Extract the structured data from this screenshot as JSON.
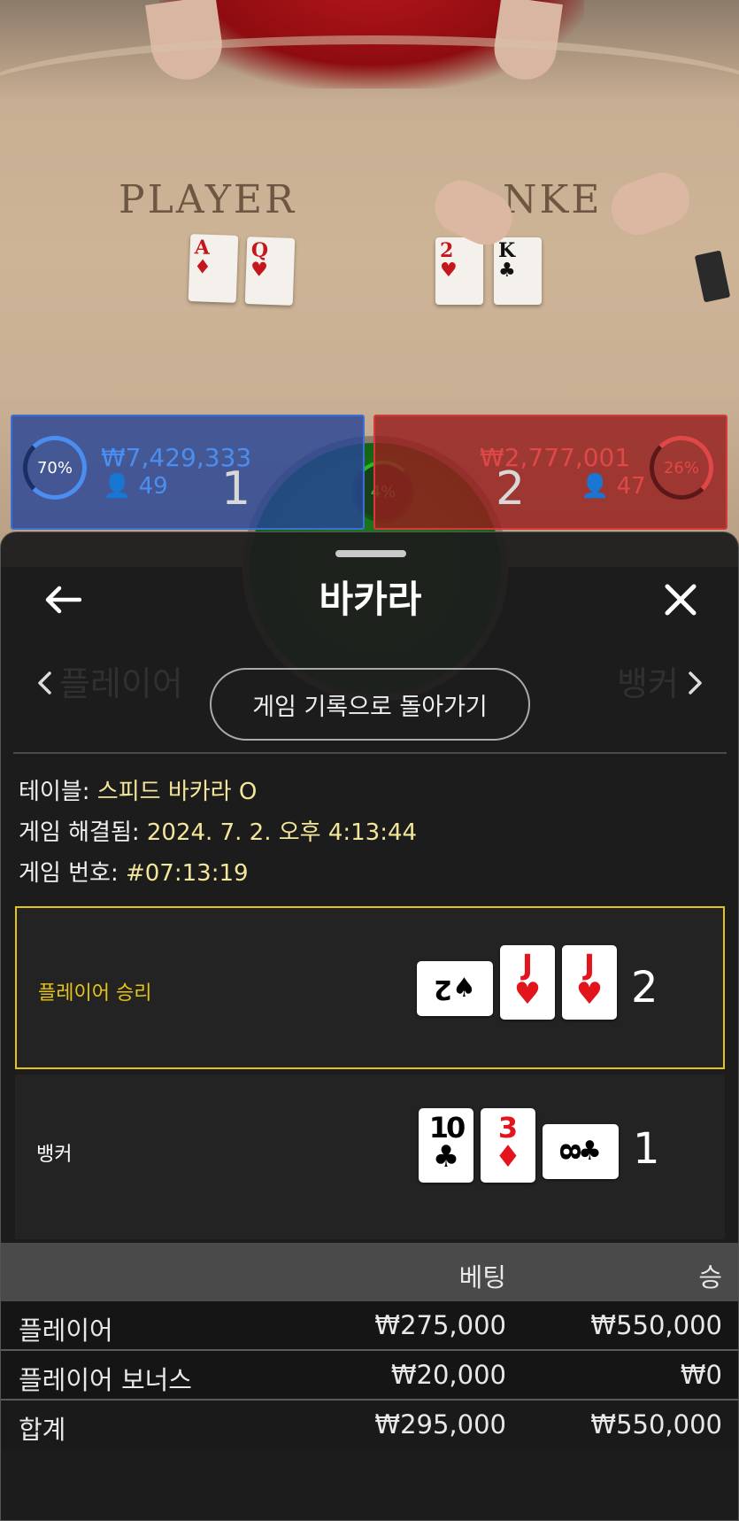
{
  "video": {
    "player_label": "PLAYER",
    "banker_label": "NKE",
    "player_cards": [
      {
        "rank": "A",
        "suit": "♦",
        "color": "red"
      },
      {
        "rank": "Q",
        "suit": "♥",
        "color": "red"
      }
    ],
    "banker_cards": [
      {
        "rank": "2",
        "suit": "♥",
        "color": "red"
      },
      {
        "rank": "K",
        "suit": "♣",
        "color": "black"
      }
    ]
  },
  "score": {
    "player": {
      "percent": "70%",
      "amount": "₩7,429,333",
      "bettors": "49",
      "points": "1",
      "color": "#3d6ed6"
    },
    "tie": {
      "percent": "4%",
      "color": "#21c021"
    },
    "banker": {
      "percent": "26%",
      "amount": "₩2,777,001",
      "bettors": "47",
      "points": "2",
      "color": "#d53a3a"
    }
  },
  "sheet": {
    "title": "바카라",
    "back_to_history": "게임 기록으로 돌아가기",
    "info": {
      "table_label": "테이블:",
      "table_value": "스피드 바카라 O",
      "resolved_label": "게임 해결됨:",
      "resolved_value": "2024. 7. 2. 오후 4:13:44",
      "game_no_label": "게임 번호:",
      "game_no_value": "#07:13:19"
    },
    "results": [
      {
        "label": "플레이어 승리",
        "label_color": "#e6c414",
        "total": "2",
        "cards": [
          {
            "rank": "2",
            "suit": "♠",
            "color": "black",
            "sideways": true
          },
          {
            "rank": "J",
            "suit": "♥",
            "color": "red",
            "sideways": false
          },
          {
            "rank": "J",
            "suit": "♥",
            "color": "red",
            "sideways": false
          }
        ]
      },
      {
        "label": "뱅커",
        "label_color": "#ffffff",
        "total": "1",
        "cards": [
          {
            "rank": "10",
            "suit": "♣",
            "color": "black",
            "sideways": false
          },
          {
            "rank": "3",
            "suit": "♦",
            "color": "red",
            "sideways": false
          },
          {
            "rank": "8",
            "suit": "♣",
            "color": "black",
            "sideways": true
          }
        ]
      }
    ],
    "bets": {
      "headers": {
        "bet": "베팅",
        "win": "승"
      },
      "rows": [
        {
          "label": "플레이어",
          "bet": "₩275,000",
          "win": "₩550,000"
        },
        {
          "label": "플레이어 보너스",
          "bet": "₩20,000",
          "win": "₩0"
        },
        {
          "label": "합계",
          "bet": "₩295,000",
          "win": "₩550,000"
        }
      ]
    }
  }
}
